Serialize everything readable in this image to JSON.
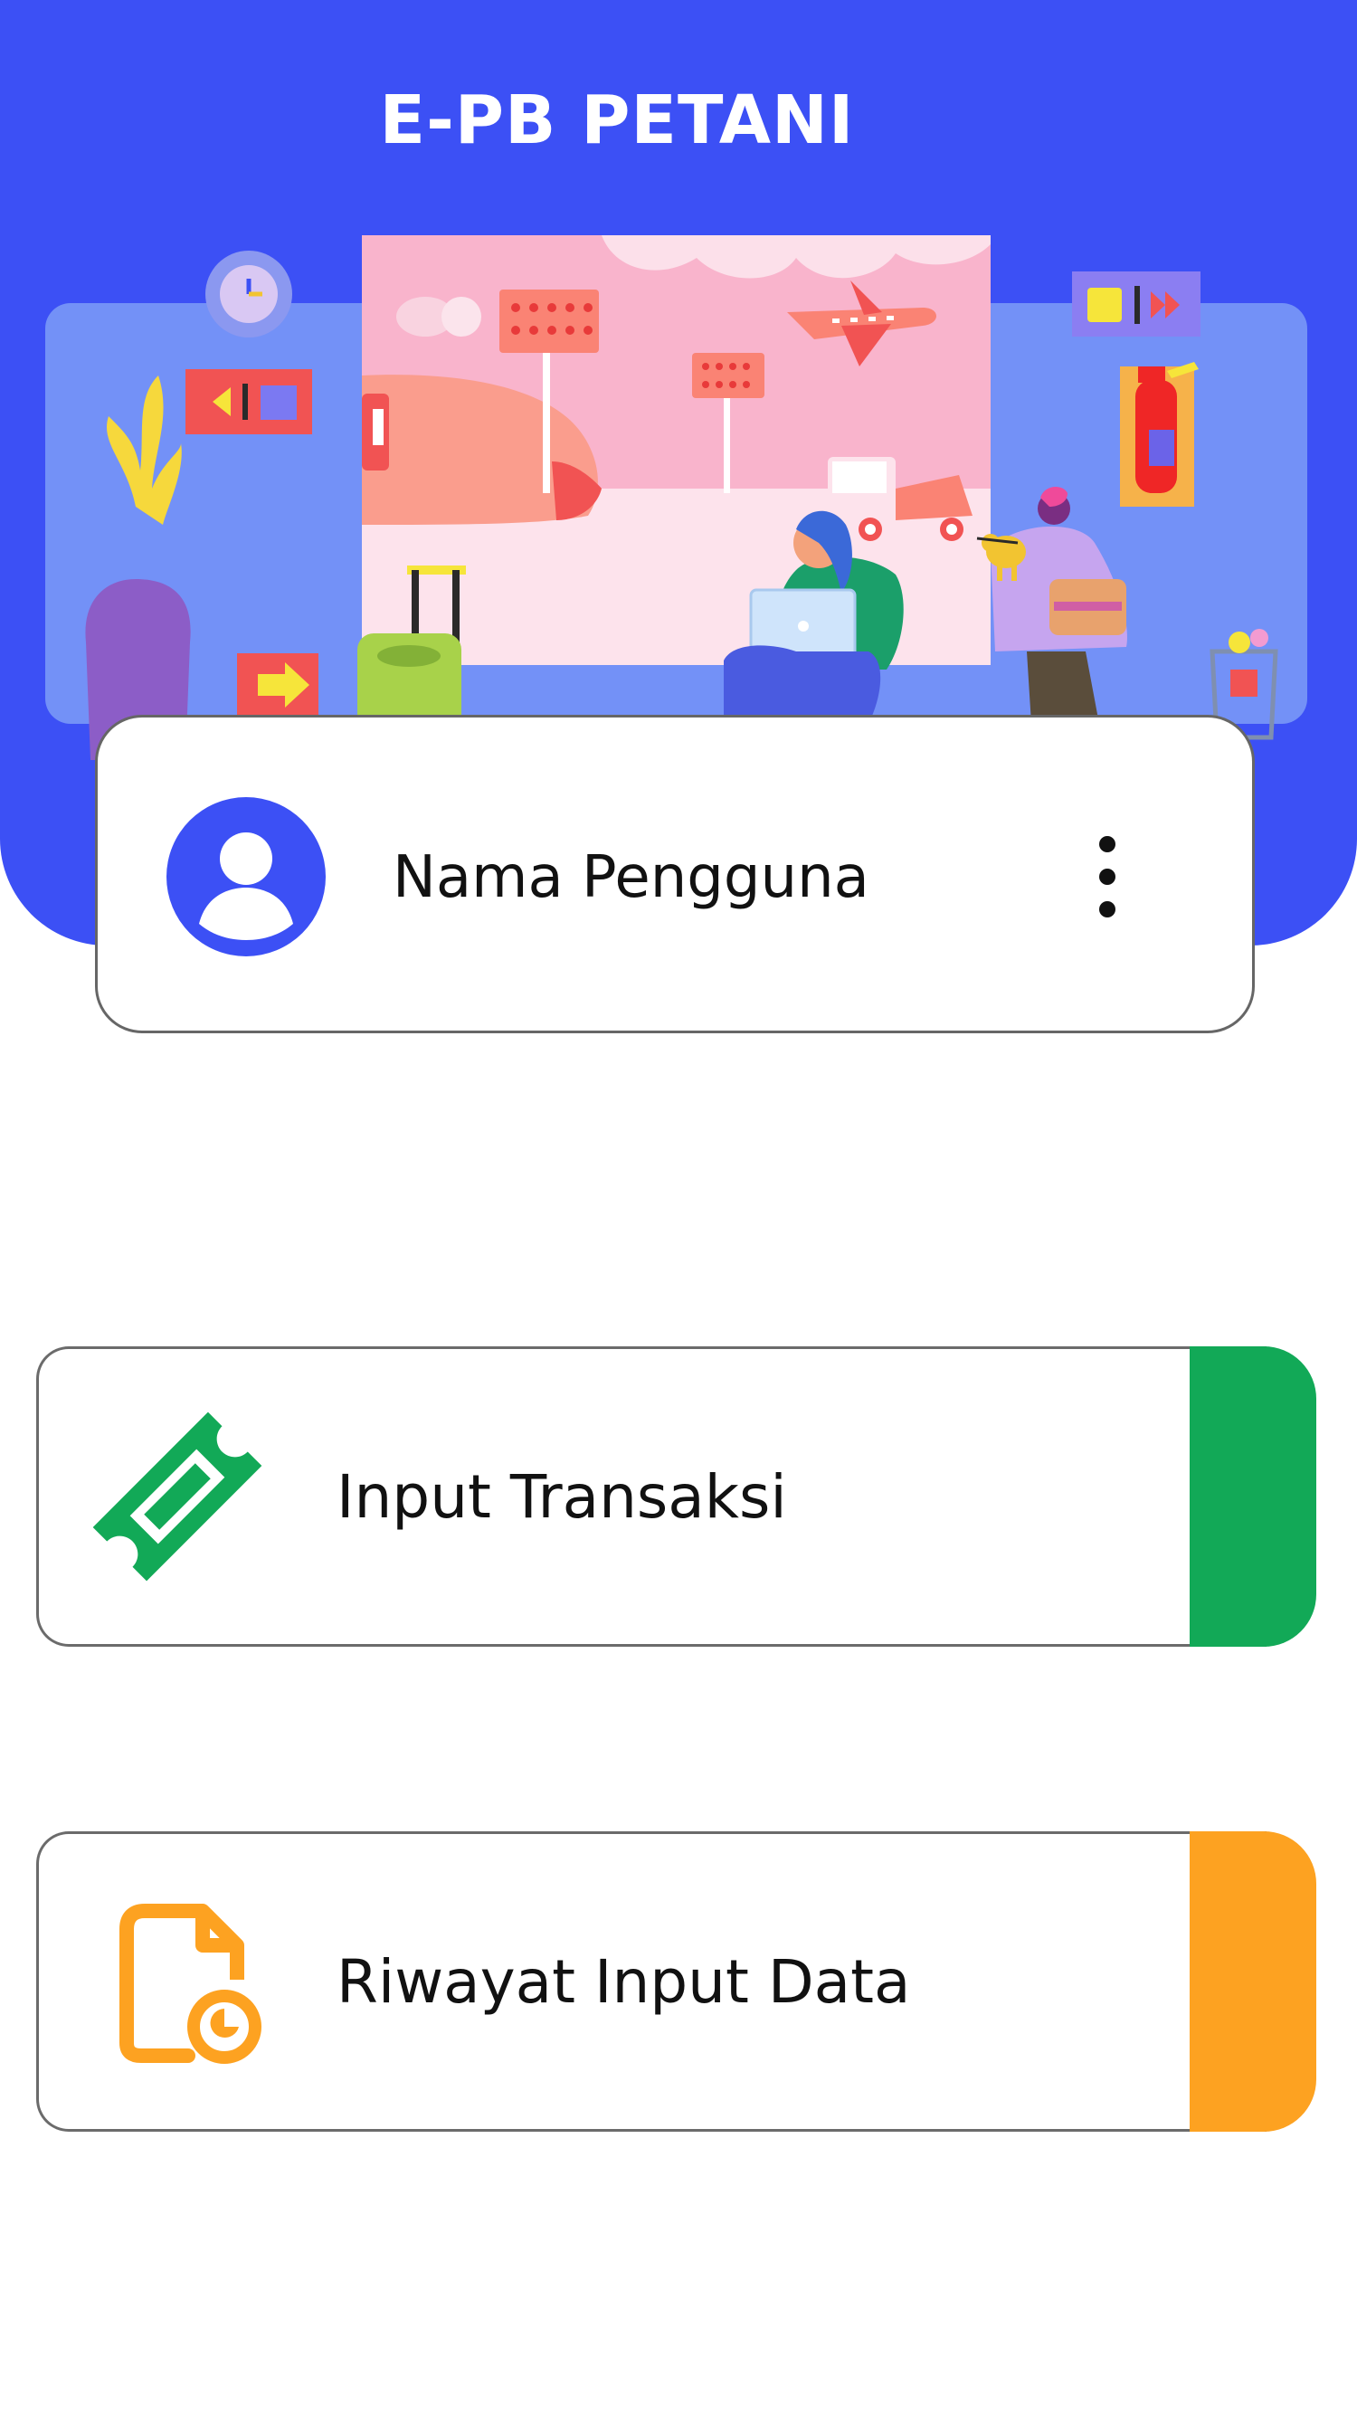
{
  "app": {
    "title": "E-PB PETANI"
  },
  "profile": {
    "user_name": "Nama Pengguna",
    "avatar_icon": "user-avatar-icon",
    "menu_icon": "more-vertical-icon"
  },
  "menu": {
    "items": [
      {
        "label": "Input Transaksi",
        "icon": "ticket-icon",
        "accent_color": "#12a957"
      },
      {
        "label": "Riwayat Input Data",
        "icon": "document-history-icon",
        "accent_color": "#fda221"
      }
    ]
  },
  "theme": {
    "primary": "#3c50f5",
    "card_border": "#666666"
  }
}
